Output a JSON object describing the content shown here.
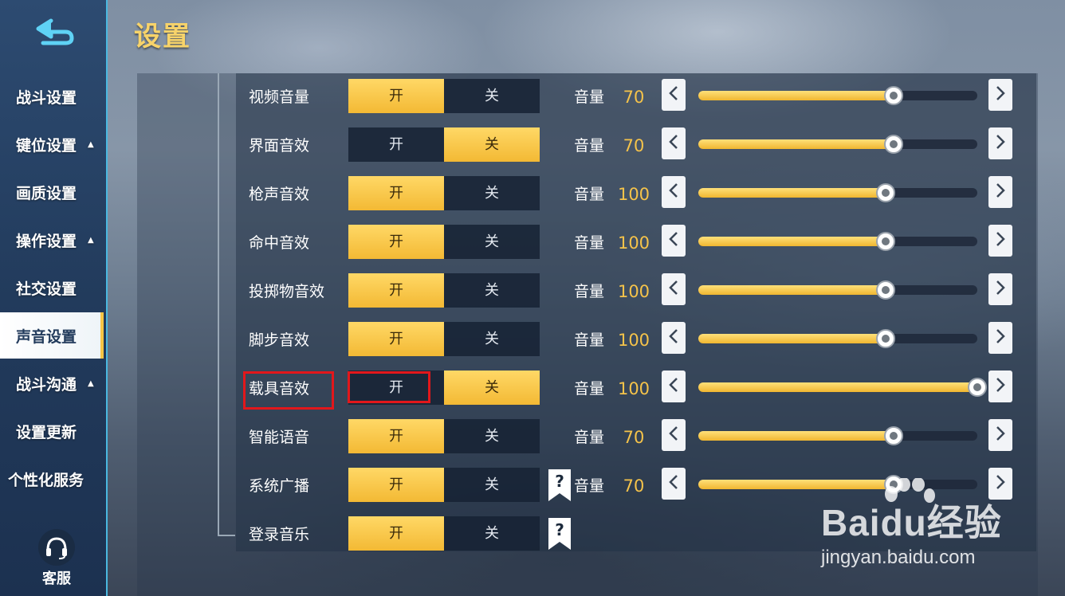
{
  "page_title": "设置",
  "sidebar": {
    "items": [
      {
        "label": "战斗设置",
        "arrow": "",
        "active": false
      },
      {
        "label": "键位设置",
        "arrow": "▲",
        "active": false
      },
      {
        "label": "画质设置",
        "arrow": "",
        "active": false
      },
      {
        "label": "操作设置",
        "arrow": "▲",
        "active": false
      },
      {
        "label": "社交设置",
        "arrow": "",
        "active": false
      },
      {
        "label": "声音设置",
        "arrow": "",
        "active": true
      },
      {
        "label": "战斗沟通",
        "arrow": "▲",
        "active": false
      },
      {
        "label": "设置更新",
        "arrow": "",
        "active": false
      },
      {
        "label": "个性化服务",
        "arrow": "",
        "active": false
      }
    ],
    "service_label": "客服"
  },
  "sound": {
    "on_label": "开",
    "off_label": "关",
    "volume_label": "音量",
    "rows": [
      {
        "label": "视频音量",
        "state": "on",
        "volume": "70",
        "level": 0.7
      },
      {
        "label": "界面音效",
        "state": "off",
        "volume": "70",
        "level": 0.7
      },
      {
        "label": "枪声音效",
        "state": "on",
        "volume": "100",
        "level": 0.67
      },
      {
        "label": "命中音效",
        "state": "on",
        "volume": "100",
        "level": 0.67
      },
      {
        "label": "投掷物音效",
        "state": "on",
        "volume": "100",
        "level": 0.67
      },
      {
        "label": "脚步音效",
        "state": "on",
        "volume": "100",
        "level": 0.67
      },
      {
        "label": "载具音效",
        "state": "off",
        "volume": "100",
        "level": 1.0
      },
      {
        "label": "智能语音",
        "state": "on",
        "volume": "70",
        "level": 0.7
      },
      {
        "label": "系统广播",
        "state": "on",
        "volume": "70",
        "level": 0.7,
        "help": true
      },
      {
        "label": "登录音乐",
        "state": "on",
        "help": true
      }
    ]
  },
  "watermark": {
    "logo": "Baidu经验",
    "url": "jingyan.baidu.com"
  },
  "colors": {
    "accent": "#f5c34a",
    "sidebar": "#223b5c",
    "highlight": "#e2171b"
  }
}
